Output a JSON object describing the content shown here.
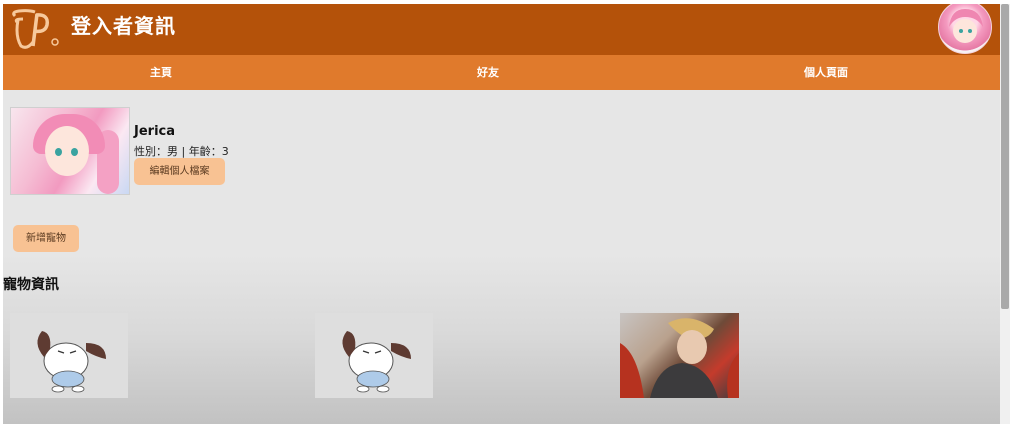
{
  "header": {
    "title": "登入者資訊",
    "logo_icon": "brand-logo",
    "avatar_icon": "user-avatar"
  },
  "nav": {
    "items": [
      "主頁",
      "好友",
      "個人頁面"
    ]
  },
  "profile": {
    "name": "Jerica",
    "info": "性別：男 | 年齡：3",
    "edit_label": "編輯個人檔案"
  },
  "actions": {
    "add_pet_label": "新增寵物"
  },
  "pets_section": {
    "title": "寵物資訊"
  },
  "colors": {
    "header_bg": "#b4520a",
    "nav_bg": "#e07a2c",
    "button_bg": "#f8c293"
  }
}
